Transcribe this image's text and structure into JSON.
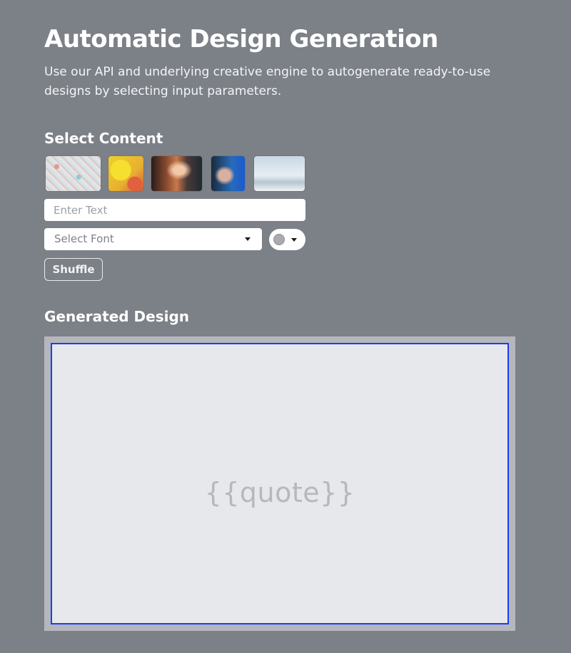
{
  "header": {
    "title": "Automatic Design Generation",
    "subtitle": "Use our API and underlying creative engine to autogenerate ready-to-use designs by selecting input parameters."
  },
  "content_section": {
    "heading": "Select Content",
    "thumbnails": [
      {
        "name": "pattern-pink-teal-image"
      },
      {
        "name": "yellow-paint-image"
      },
      {
        "name": "blurred-lights-image"
      },
      {
        "name": "blurred-portrait-image"
      },
      {
        "name": "clouds-sky-image"
      }
    ],
    "text_input": {
      "value": "",
      "placeholder": "Enter Text"
    },
    "font_select": {
      "selected": "Select Font",
      "icon": "chevron-down-icon"
    },
    "color_picker": {
      "swatch_color": "#a9abb0",
      "icon": "chevron-down-icon"
    },
    "shuffle_label": "Shuffle"
  },
  "design_section": {
    "heading": "Generated Design",
    "placeholder": "{{quote}}",
    "border_color": "#1b3ef0"
  }
}
